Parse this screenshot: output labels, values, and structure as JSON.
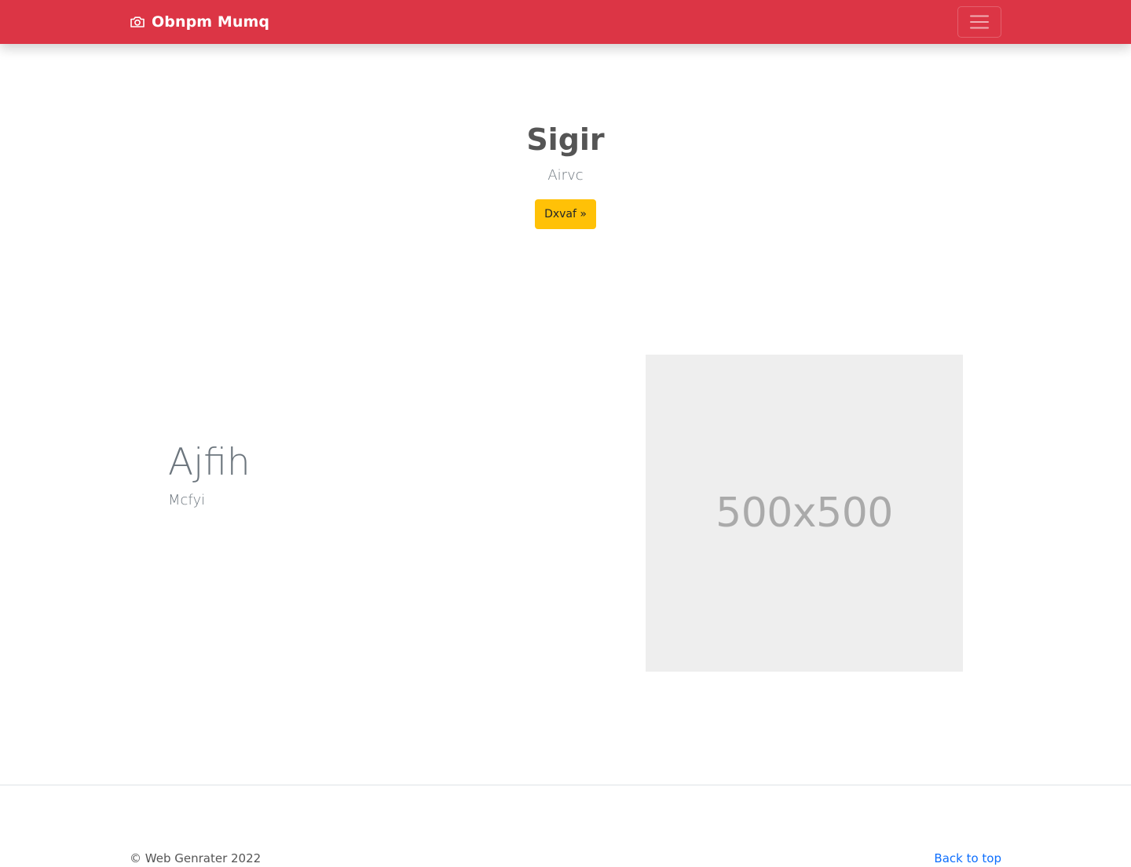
{
  "navbar": {
    "brand": "Obnpm Mumq",
    "brand_icon": "camera-icon",
    "toggler_icon": "hamburger-menu-icon",
    "background_color": "#dc3545"
  },
  "hero": {
    "title": "Sigir",
    "lead": "Airvc",
    "button_label": "Dxvaf »",
    "button_color": "#ffc107"
  },
  "feature": {
    "heading": "Ajfih",
    "lead": "Mcfyi",
    "image_placeholder_text": "500x500"
  },
  "footer": {
    "copyright": "© Web Genrater 2022",
    "back_to_top": "Back to top",
    "link_color": "#0d6efd"
  }
}
